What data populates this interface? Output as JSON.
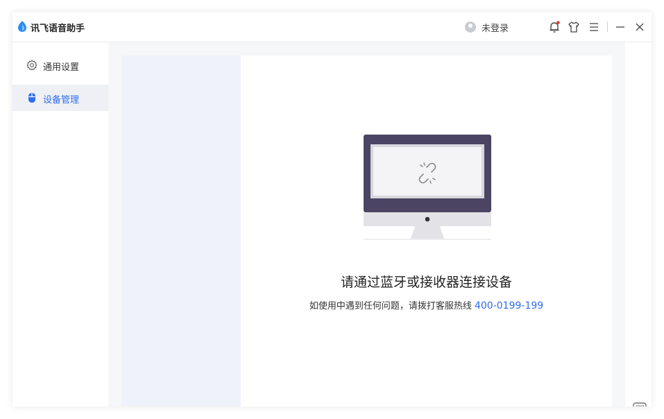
{
  "app": {
    "title": "讯飞语音助手",
    "accent_color": "#2f6bf0"
  },
  "titlebar": {
    "login_label": "未登录",
    "icons": [
      "user-avatar-icon",
      "bell-icon",
      "shirt-icon",
      "menu-icon",
      "minimize-icon",
      "close-icon"
    ],
    "notification_dot_color": "#e53935"
  },
  "sidebar": {
    "items": [
      {
        "label": "通用设置",
        "icon": "gear-icon",
        "active": false
      },
      {
        "label": "设备管理",
        "icon": "mouse-icon",
        "active": true
      }
    ]
  },
  "main": {
    "message": "请通过蓝牙或接收器连接设备",
    "hint_prefix": "如使用中遇到任何问题，请拨打客服热线",
    "hotline": "400-0199-199",
    "illustration_icon": "broken-link-icon"
  },
  "footer": {
    "icon": "keyboard-icon"
  }
}
